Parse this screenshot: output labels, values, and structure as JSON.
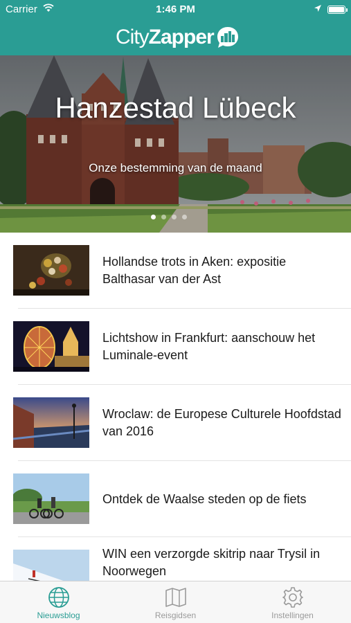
{
  "status_bar": {
    "carrier": "Carrier",
    "time": "1:46 PM"
  },
  "header": {
    "logo_part1": "City",
    "logo_part2": "Zapper"
  },
  "hero": {
    "title": "Hanzestad Lübeck",
    "subtitle": "Onze bestemming van de maand",
    "pages": 4,
    "active_page": 1
  },
  "articles": [
    {
      "title": "Hollandse trots in Aken: expositie Balthasar van der Ast"
    },
    {
      "title": "Lichtshow in Frankfurt: aanschouw het Luminale-event"
    },
    {
      "title": "Wroclaw: de Europese Culturele Hoofdstad van 2016"
    },
    {
      "title": "Ontdek de Waalse steden op de fiets"
    },
    {
      "title": "WIN een verzorgde skitrip naar Trysil in Noorwegen"
    }
  ],
  "tabs": [
    {
      "label": "Nieuwsblog",
      "icon": "globe-icon",
      "active": true
    },
    {
      "label": "Reisgidsen",
      "icon": "map-icon",
      "active": false
    },
    {
      "label": "Instellingen",
      "icon": "gear-icon",
      "active": false
    }
  ],
  "colors": {
    "brand": "#2a9d94",
    "tab_inactive": "#9a9a9a"
  }
}
